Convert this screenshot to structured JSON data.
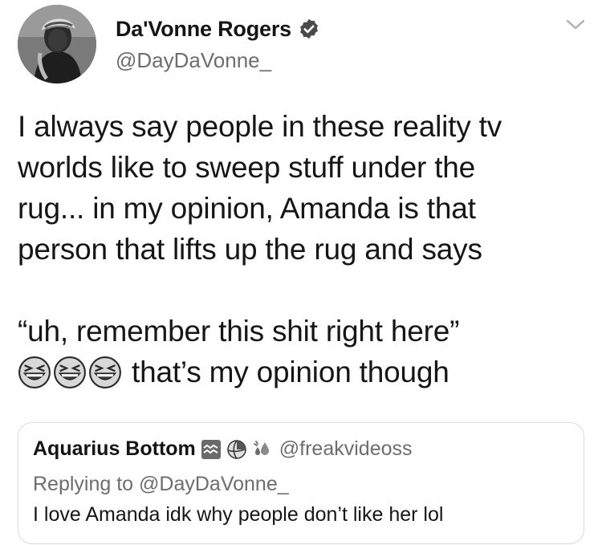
{
  "author": {
    "display_name": "Da'Vonne Rogers",
    "handle": "@DayDaVonne_",
    "verified": true,
    "avatar_icon": "profile-photo"
  },
  "tweet": {
    "lines": [
      "I always say people in these reality tv",
      "worlds like to sweep stuff under the",
      "rug... in my opinion, Amanda is that",
      "person that lifts up the rug and says"
    ],
    "quote_line": "“uh, remember this shit right here”",
    "emoji_icons": [
      "grinning-squinting-face-icon",
      "grinning-squinting-face-icon",
      "grinning-squinting-face-icon"
    ],
    "closing": "that’s my opinion though"
  },
  "quoted_tweet": {
    "display_name": "Aquarius Bottom",
    "name_icons": [
      "aquarius-symbol-icon",
      "volleyball-icon",
      "splashing-sweat-icon"
    ],
    "handle": "@freakvideoss",
    "replying_to": "Replying to @DayDaVonne_",
    "text": "I love Amanda idk why people don’t like her lol"
  },
  "colors": {
    "text": "#161616",
    "secondary": "#6d6d6d",
    "border": "#d9d9d9",
    "verified_badge": "#4a4a4a"
  }
}
